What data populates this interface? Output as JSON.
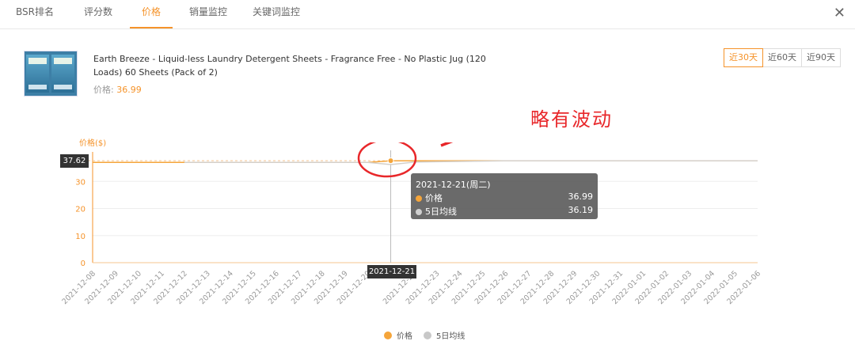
{
  "tabs": [
    "BSR排名",
    "评分数",
    "价格",
    "销量监控",
    "关键词监控"
  ],
  "active_tab": 2,
  "close_label": "✕",
  "product": {
    "title": "Earth Breeze - Liquid-less Laundry Detergent Sheets - Fragrance Free - No Plastic Jug (120 Loads) 60 Sheets (Pack of 2)",
    "price_label": "价格: ",
    "price_value": "36.99"
  },
  "range_buttons": [
    "近30天",
    "近60天",
    "近90天"
  ],
  "active_range": 0,
  "annotation": "略有波动",
  "colors": {
    "accent": "#f5932a",
    "ma": "#c0c0c0",
    "annotation": "#e8272a"
  },
  "chart_data": {
    "type": "line",
    "ylabel": "价格($)",
    "ylim": [
      0,
      40
    ],
    "yticks": [
      0,
      10,
      20,
      30
    ],
    "categories": [
      "2021-12-08",
      "2021-12-09",
      "2021-12-10",
      "2021-12-11",
      "2021-12-12",
      "2021-12-13",
      "2021-12-14",
      "2021-12-15",
      "2021-12-16",
      "2021-12-17",
      "2021-12-18",
      "2021-12-19",
      "2021-12-20",
      "2021-12-21",
      "2021-12-22",
      "2021-12-23",
      "2021-12-24",
      "2021-12-25",
      "2021-12-26",
      "2021-12-27",
      "2021-12-28",
      "2021-12-29",
      "2021-12-30",
      "2021-12-31",
      "2022-01-01",
      "2022-01-02",
      "2022-01-03",
      "2022-01-04",
      "2022-01-05",
      "2022-01-06"
    ],
    "series": [
      {
        "name": "价格",
        "values": [
          36.99,
          36.99,
          36.99,
          36.99,
          36.99,
          36.99,
          36.99,
          36.99,
          36.99,
          36.99,
          36.99,
          36.99,
          36.99,
          37.62,
          37.62,
          37.62,
          37.62,
          37.62,
          37.62,
          37.62,
          37.62,
          37.62,
          37.62,
          37.62,
          37.62,
          37.62,
          37.62,
          37.62,
          37.62,
          37.62
        ]
      },
      {
        "name": "5日均线",
        "values": [
          null,
          null,
          null,
          null,
          36.99,
          36.99,
          36.99,
          36.99,
          36.99,
          36.99,
          36.99,
          36.99,
          36.99,
          36.19,
          37.12,
          37.25,
          37.37,
          37.5,
          37.62,
          37.62,
          37.62,
          37.62,
          37.62,
          37.62,
          37.62,
          37.62,
          37.62,
          37.62,
          37.62,
          37.62
        ]
      }
    ],
    "highlight_index": 13,
    "crosshair_y_value": 37.62,
    "crosshair_y_label": "37.62",
    "crosshair_x_label": "2021-12-21",
    "tooltip": {
      "date": "2021-12-21(周二)",
      "rows": [
        {
          "name": "价格",
          "value": "36.99"
        },
        {
          "name": "5日均线",
          "value": "36.19"
        }
      ]
    },
    "legend": [
      "价格",
      "5日均线"
    ]
  }
}
